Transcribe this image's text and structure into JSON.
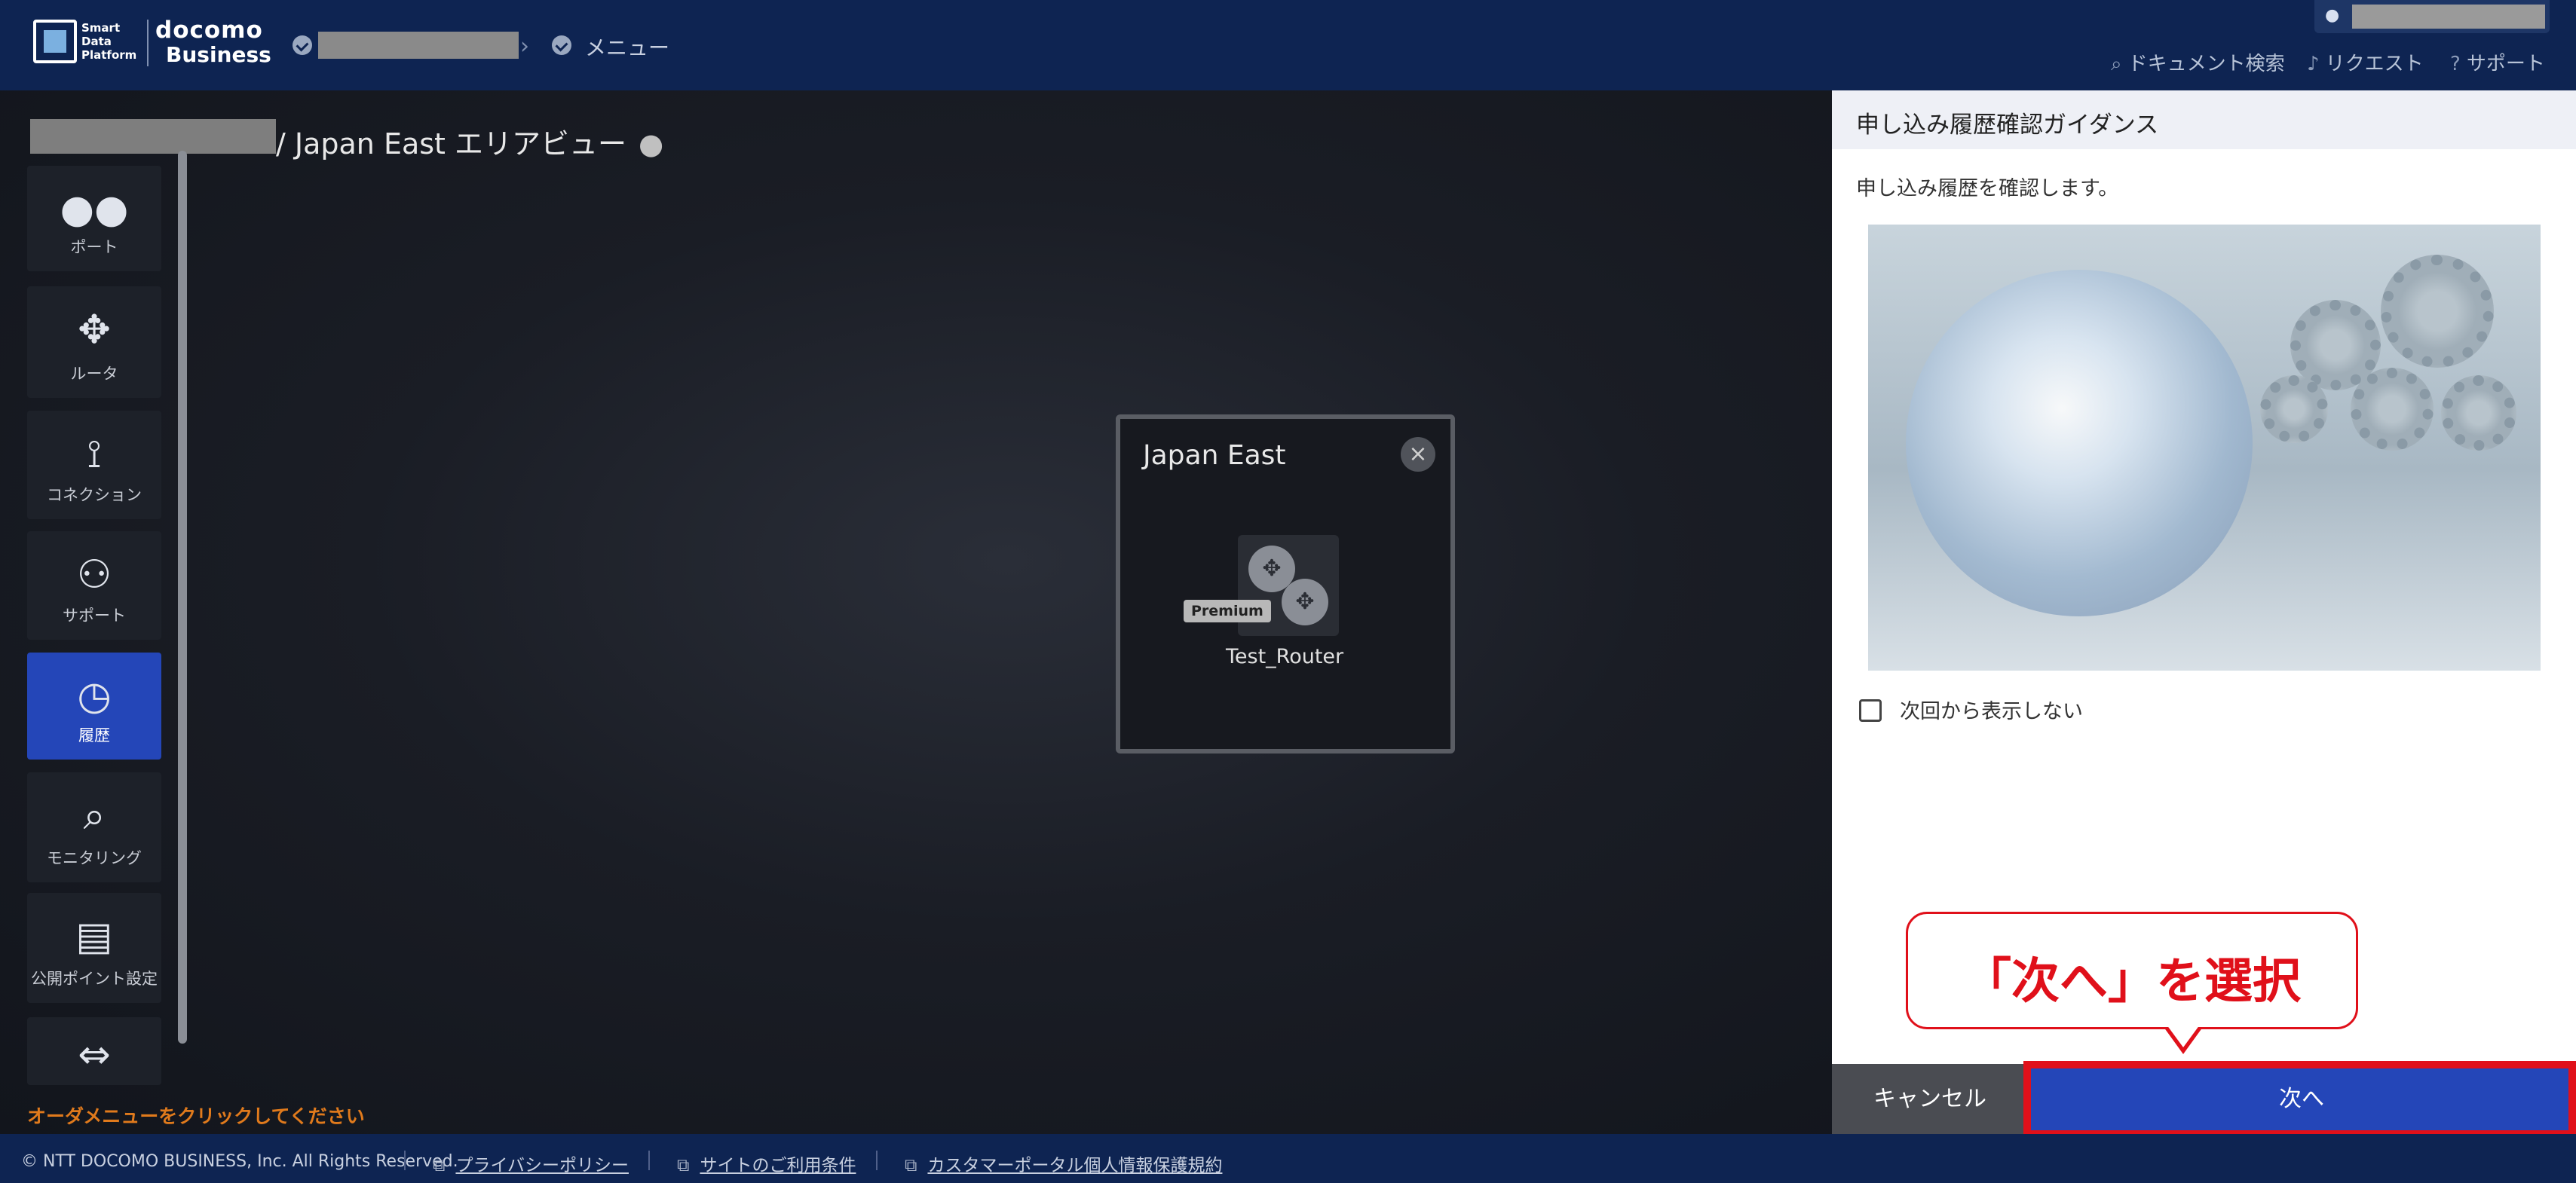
{
  "header": {
    "logo_sdp": "Smart Data Platform",
    "logo_docomo": "docomo",
    "logo_business": "Business",
    "breadcrumb_menu": "メニュー",
    "links": [
      {
        "label": "ドキュメント検索",
        "icon": "search-icon"
      },
      {
        "label": "リクエスト",
        "icon": "bell-icon"
      },
      {
        "label": "サポート",
        "icon": "help-icon"
      }
    ]
  },
  "main": {
    "area_title": "/ Japan East エリアビュー",
    "order_hint": "オーダメニューをクリックしてください"
  },
  "sidebar": {
    "items": [
      {
        "label": "ポート",
        "icon": "port-icon"
      },
      {
        "label": "ルータ",
        "icon": "router-icon"
      },
      {
        "label": "コネクション",
        "icon": "connection-icon"
      },
      {
        "label": "サポート",
        "icon": "support-user-icon"
      },
      {
        "label": "履歴",
        "icon": "history-icon",
        "active": true
      },
      {
        "label": "モニタリング",
        "icon": "monitoring-icon"
      },
      {
        "label": "公開ポイント設定",
        "icon": "display-icon"
      },
      {
        "label": "",
        "icon": "plug-icon"
      }
    ]
  },
  "area_box": {
    "name": "Japan East",
    "router": {
      "badge": "Premium",
      "name": "Test_Router"
    }
  },
  "panel": {
    "title": "申し込み履歴確認ガイダンス",
    "description": "申し込み履歴を確認します。",
    "checkbox_label": "次回から表示しない",
    "cancel_label": "キャンセル",
    "next_label": "次へ",
    "callout": "「次へ」を選択"
  },
  "footer": {
    "copyright": "© NTT DOCOMO BUSINESS, Inc. All Rights Reserved.",
    "links": [
      "プライバシーポリシー",
      "サイトのご利用条件",
      "カスタマーポータル個人情報保護規約"
    ]
  }
}
